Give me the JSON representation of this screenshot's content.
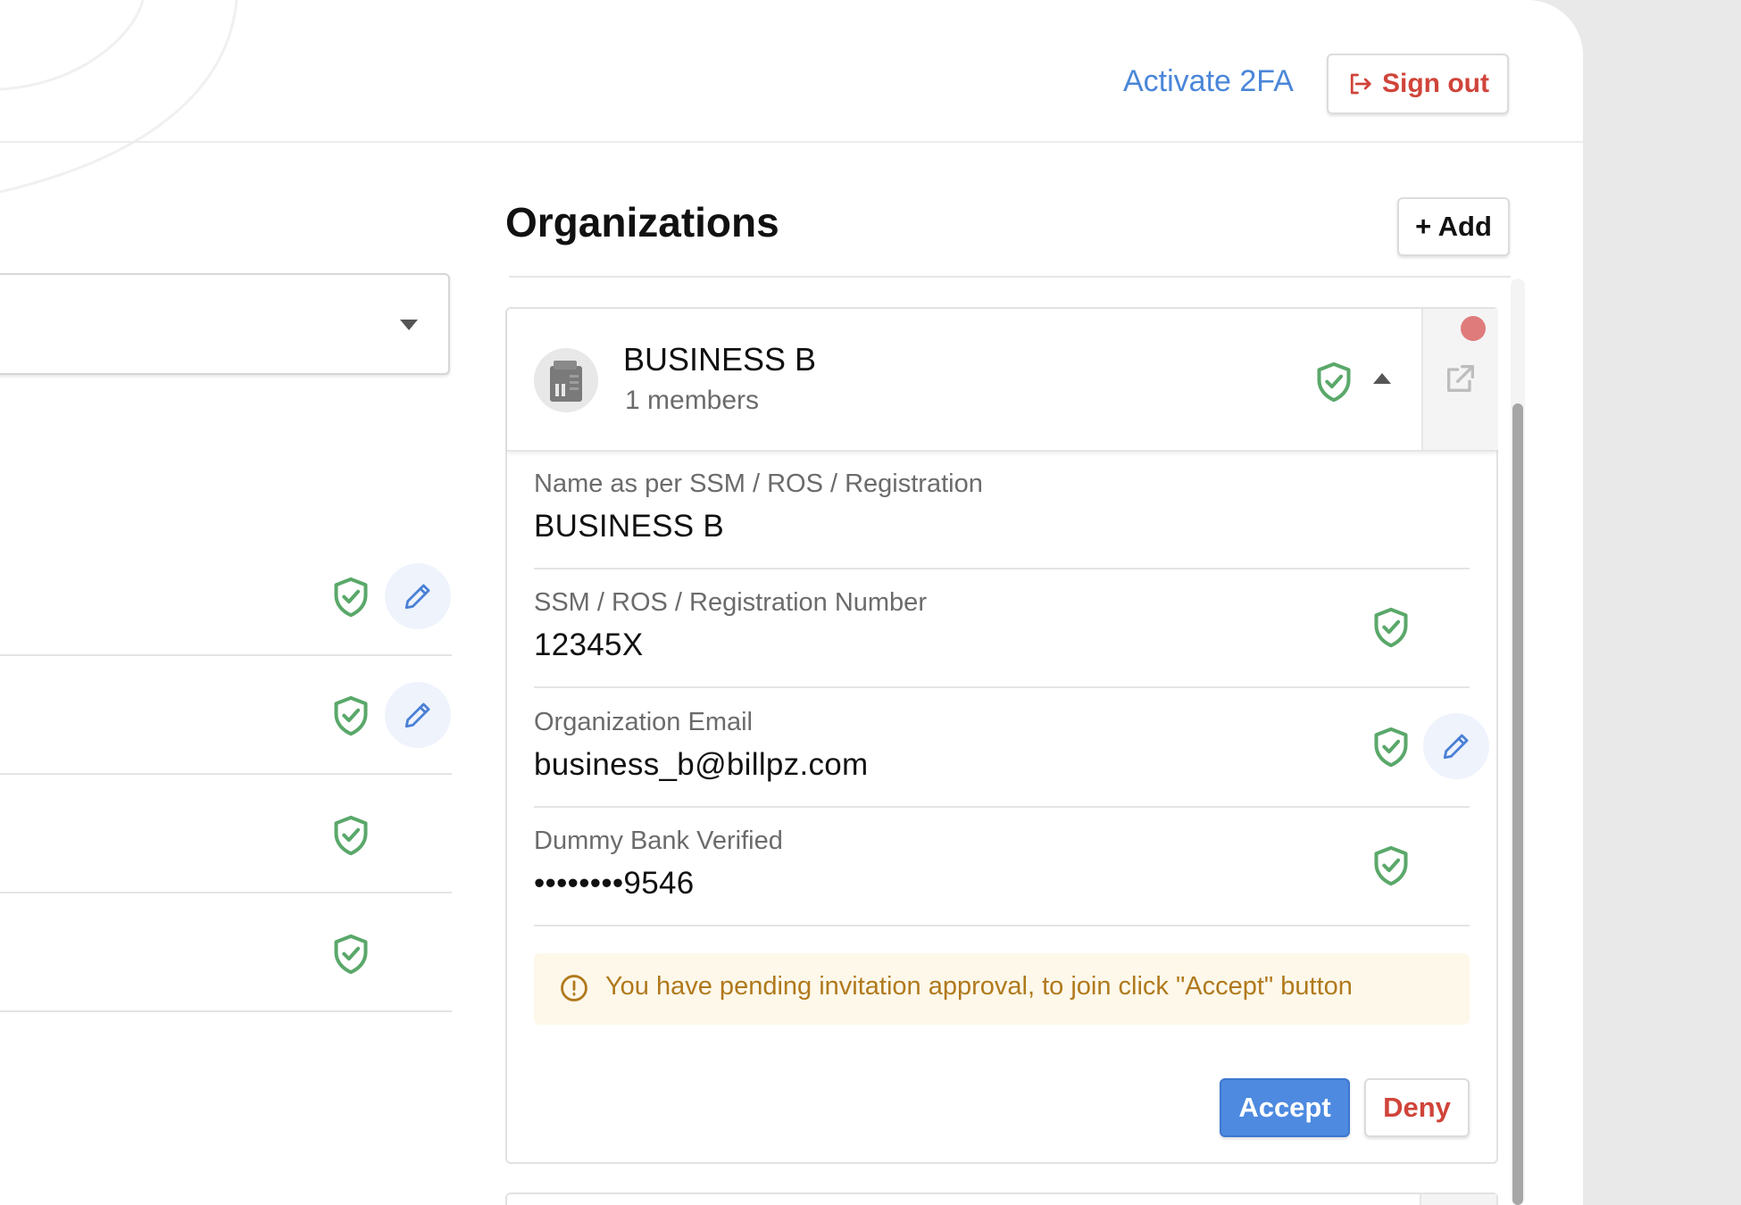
{
  "header": {
    "activate_2fa_label": "Activate 2FA",
    "sign_out_label": "Sign out"
  },
  "organizations": {
    "title": "Organizations",
    "add_label": "+ Add",
    "card": {
      "name": "BUSINESS B",
      "members": "1 members",
      "fields": [
        {
          "label": "Name as per SSM / ROS / Registration",
          "value": "BUSINESS B"
        },
        {
          "label": "SSM / ROS / Registration Number",
          "value": "12345X"
        },
        {
          "label": "Organization Email",
          "value": "business_b@billpz.com"
        },
        {
          "label": "Dummy Bank Verified",
          "value": "••••••••9546"
        }
      ],
      "alert": "You have pending invitation approval, to join click \"Accept\" button",
      "accept_label": "Accept",
      "deny_label": "Deny"
    }
  },
  "icons": {
    "verified": "shield-check-icon",
    "edit": "pencil-icon",
    "sign_out": "sign-out-icon",
    "external": "external-link-icon",
    "building": "building-icon",
    "info": "info-circle-icon"
  },
  "colors": {
    "accent_blue": "#4d8ae0",
    "danger_red": "#d0443a",
    "verified_green": "#5aa86a",
    "warning_text": "#b0791c",
    "warning_bg": "#fdf8ea",
    "status_dot": "#e07b7b"
  }
}
